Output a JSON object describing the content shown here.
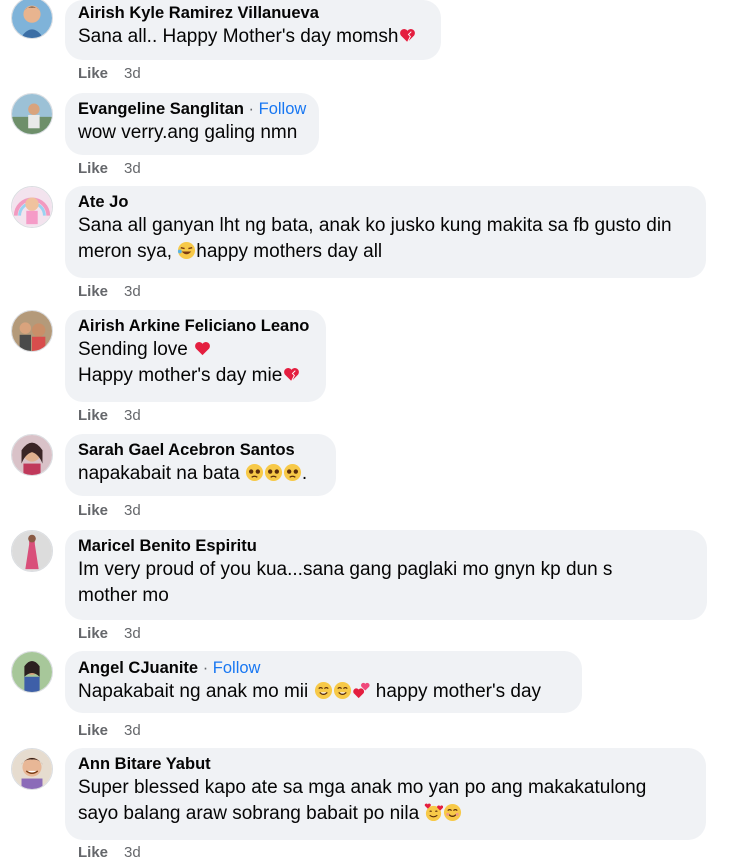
{
  "comments": [
    {
      "author": "Airish Kyle Ramirez Villanueva",
      "lines": [
        "Sana all.. Happy Mother's day momsh"
      ],
      "like_label": "Like",
      "time": "3d",
      "avatar_icon": "profile-photo-child"
    },
    {
      "author": "Evangeline Sanglitan",
      "follow_label": "Follow",
      "lines": [
        "wow verry.ang galing nmn"
      ],
      "like_label": "Like",
      "time": "3d",
      "avatar_icon": "profile-photo-outdoor"
    },
    {
      "author": "Ate Jo",
      "lines": [
        "Sana all ganyan lht ng bata, anak ko jusko kung makita sa fb gusto din",
        "meron sya, ",
        "happy mothers day all"
      ],
      "like_label": "Like",
      "time": "3d",
      "avatar_icon": "profile-photo-rainbow"
    },
    {
      "author": "Airish Arkine Feliciano Leano",
      "lines": [
        "Sending love ",
        "Happy mother's day mie"
      ],
      "like_label": "Like",
      "time": "3d",
      "avatar_icon": "profile-photo-family"
    },
    {
      "author": "Sarah Gael Acebron Santos",
      "lines": [
        "napakabait na bata ",
        "."
      ],
      "like_label": "Like",
      "time": "3d",
      "avatar_icon": "profile-photo-woman"
    },
    {
      "author": "Maricel Benito Espiritu",
      "lines": [
        "Im very proud of you kua...sana gang paglaki mo gnyn kp dun s",
        "mother mo"
      ],
      "like_label": "Like",
      "time": "3d",
      "avatar_icon": "profile-photo-pink-dress"
    },
    {
      "author": "Angel CJuanite",
      "follow_label": "Follow",
      "lines": [
        "Napakabait ng anak mo mii ",
        " happy mother's day"
      ],
      "like_label": "Like",
      "time": "3d",
      "avatar_icon": "profile-photo-garden"
    },
    {
      "author": "Ann Bitare Yabut",
      "lines": [
        "Super blessed kapo ate sa mga anak mo yan po ang makakatulong",
        "sayo balang araw sobrang babait po nila "
      ],
      "like_label": "Like",
      "time": "3d",
      "avatar_icon": "profile-photo-smiling"
    }
  ],
  "colors": {
    "bubble": "#f0f2f5",
    "text": "#050505",
    "meta": "#65676b",
    "follow": "#1877f2",
    "heart": "#e41e3f"
  }
}
